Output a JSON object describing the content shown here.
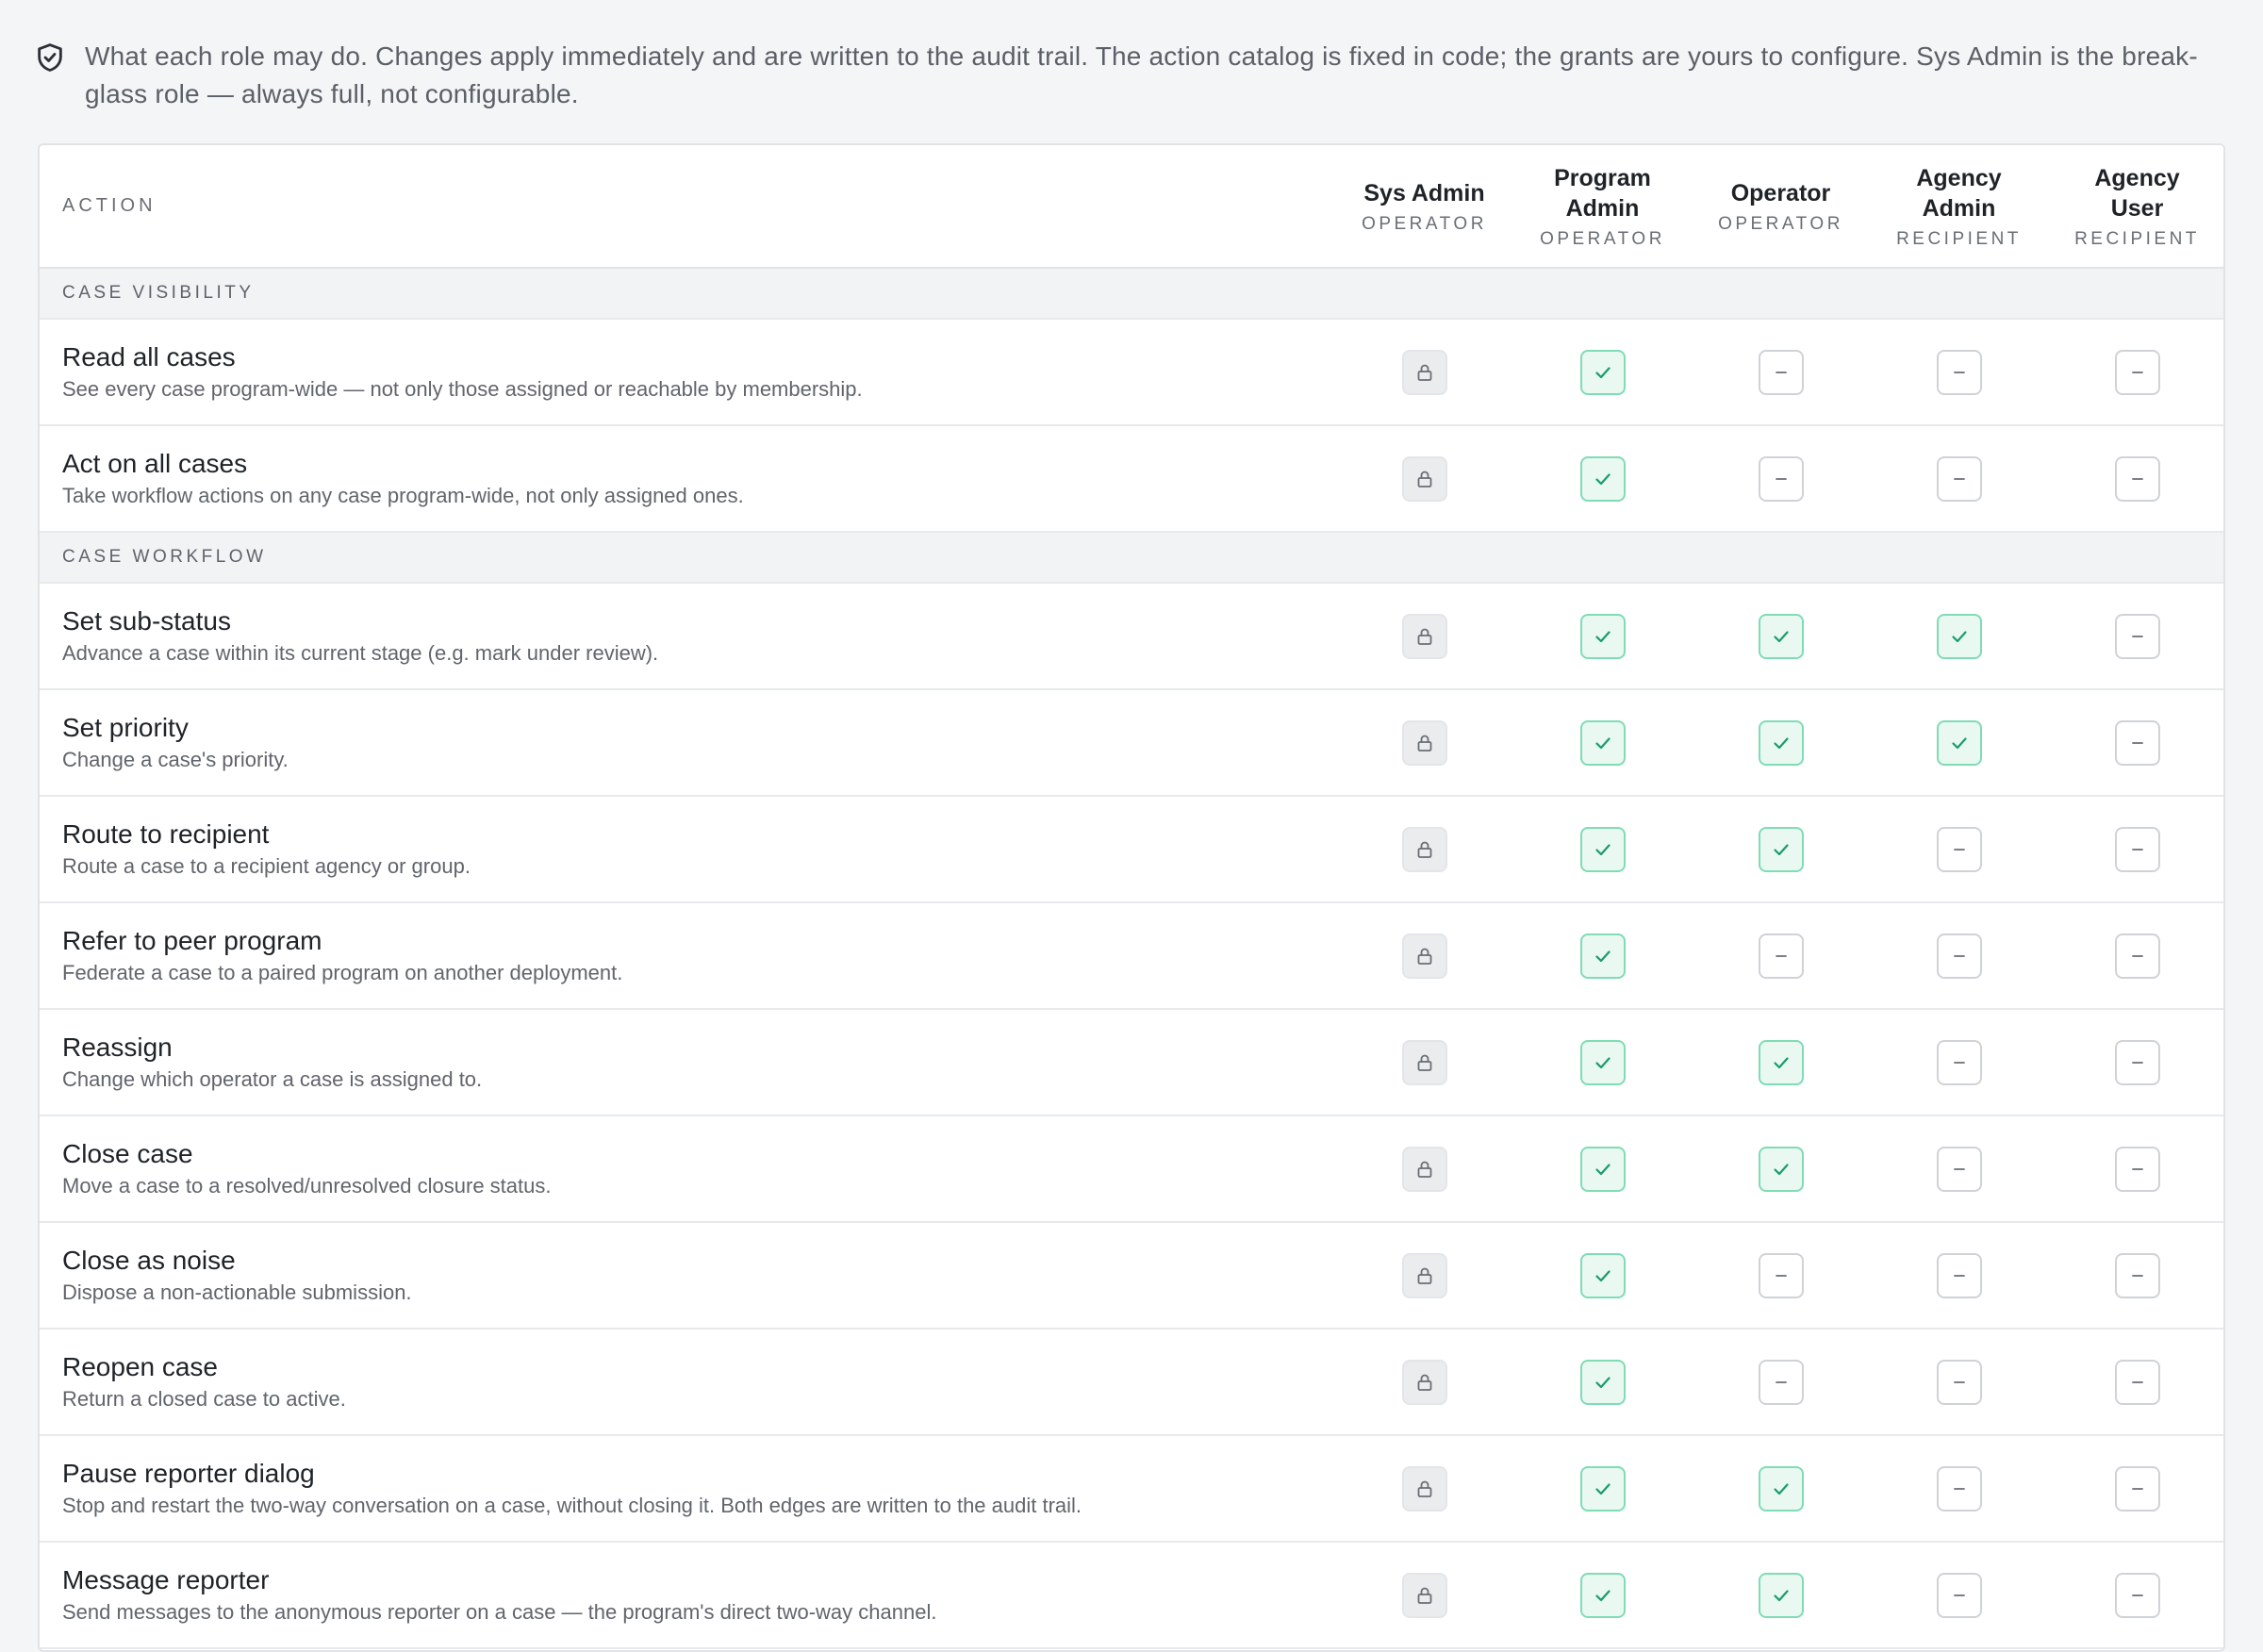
{
  "intro": {
    "text": "What each role may do. Changes apply immediately and are written to the audit trail. The action catalog is fixed in code; the grants are yours to configure. Sys Admin is the break-glass role — always full, not configurable."
  },
  "colors": {
    "granted_fill": "#e9f9f2",
    "granted_border": "#7fdcb5",
    "granted_check": "#1a9b6c",
    "denied_border": "#cfd2d7",
    "locked_fill": "#ebecee"
  },
  "icons": {
    "intro": "shield-check-icon",
    "locked": "lock-icon",
    "granted": "check-icon",
    "denied": "minus-icon"
  },
  "table": {
    "action_header": "ACTION",
    "roles": [
      {
        "name": "Sys Admin",
        "kind": "OPERATOR"
      },
      {
        "name": "Program Admin",
        "kind": "OPERATOR"
      },
      {
        "name": "Operator",
        "kind": "OPERATOR"
      },
      {
        "name": "Agency Admin",
        "kind": "RECIPIENT"
      },
      {
        "name": "Agency User",
        "kind": "RECIPIENT"
      }
    ],
    "sections": [
      {
        "label": "CASE VISIBILITY",
        "actions": [
          {
            "title": "Read all cases",
            "desc": "See every case program-wide — not only those assigned or reachable by membership.",
            "grants": [
              "locked",
              "on",
              "off",
              "off",
              "off"
            ]
          },
          {
            "title": "Act on all cases",
            "desc": "Take workflow actions on any case program-wide, not only assigned ones.",
            "grants": [
              "locked",
              "on",
              "off",
              "off",
              "off"
            ]
          }
        ]
      },
      {
        "label": "CASE WORKFLOW",
        "actions": [
          {
            "title": "Set sub-status",
            "desc": "Advance a case within its current stage (e.g. mark under review).",
            "grants": [
              "locked",
              "on",
              "on",
              "on",
              "off"
            ]
          },
          {
            "title": "Set priority",
            "desc": "Change a case's priority.",
            "grants": [
              "locked",
              "on",
              "on",
              "on",
              "off"
            ]
          },
          {
            "title": "Route to recipient",
            "desc": "Route a case to a recipient agency or group.",
            "grants": [
              "locked",
              "on",
              "on",
              "off",
              "off"
            ]
          },
          {
            "title": "Refer to peer program",
            "desc": "Federate a case to a paired program on another deployment.",
            "grants": [
              "locked",
              "on",
              "off",
              "off",
              "off"
            ]
          },
          {
            "title": "Reassign",
            "desc": "Change which operator a case is assigned to.",
            "grants": [
              "locked",
              "on",
              "on",
              "off",
              "off"
            ]
          },
          {
            "title": "Close case",
            "desc": "Move a case to a resolved/unresolved closure status.",
            "grants": [
              "locked",
              "on",
              "on",
              "off",
              "off"
            ]
          },
          {
            "title": "Close as noise",
            "desc": "Dispose a non-actionable submission.",
            "grants": [
              "locked",
              "on",
              "off",
              "off",
              "off"
            ]
          },
          {
            "title": "Reopen case",
            "desc": "Return a closed case to active.",
            "grants": [
              "locked",
              "on",
              "off",
              "off",
              "off"
            ]
          },
          {
            "title": "Pause reporter dialog",
            "desc": "Stop and restart the two-way conversation on a case, without closing it. Both edges are written to the audit trail.",
            "grants": [
              "locked",
              "on",
              "on",
              "off",
              "off"
            ]
          },
          {
            "title": "Message reporter",
            "desc": "Send messages to the anonymous reporter on a case — the program's direct two-way channel.",
            "grants": [
              "locked",
              "on",
              "on",
              "off",
              "off"
            ]
          }
        ]
      }
    ]
  }
}
